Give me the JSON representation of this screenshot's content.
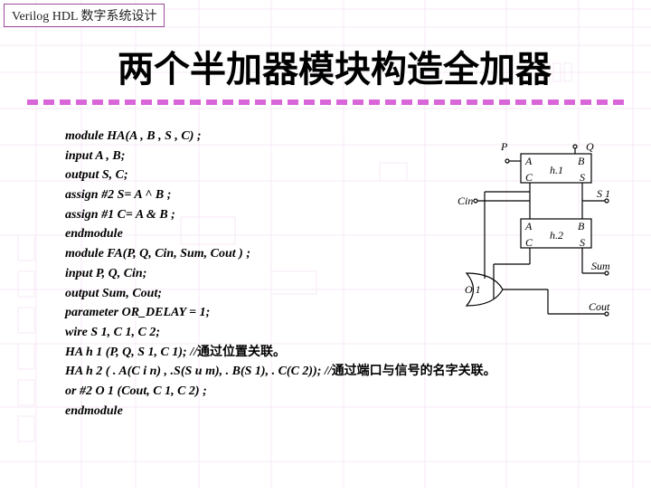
{
  "header_tag": "Verilog HDL 数字系统设计",
  "title": "两个半加器模块构造全加器",
  "code": {
    "l1": "module HA(A , B , S , C) ;",
    "l2": "input A , B;",
    "l3": "output S, C;",
    "l4": "assign #2 S= A ^ B ;",
    "l5": "assign #1 C= A & B ;",
    "l6": "endmodule",
    "l7": "module FA(P, Q, Cin, Sum, Cout ) ;",
    "l8": "input P, Q, Cin;",
    "l9": "output Sum, Cout;",
    "l10": "parameter OR_DELAY = 1;",
    "l11": "wire S 1, C 1, C 2;",
    "l12a": "HA h 1 (P, Q, S 1, C 1); //",
    "l12b": "通过位置关联。",
    "l13a": "HA h 2 ( . A(C i n) , .S(S u m), . B(S 1), . C(C 2)); //",
    "l13b": "通过端口与信号的名字关联。",
    "l14": "or #2 O 1 (Cout, C 1, C 2) ;",
    "l15": "endmodule"
  },
  "diagram": {
    "P": "P",
    "Q": "Q",
    "A": "A",
    "B": "B",
    "h1": "h.1",
    "S": "S",
    "C": "C",
    "Cin": "Cin",
    "S1": "S 1",
    "h2": "h.2",
    "O1": "O 1",
    "Sum": "Sum",
    "Cout": "Cout"
  }
}
